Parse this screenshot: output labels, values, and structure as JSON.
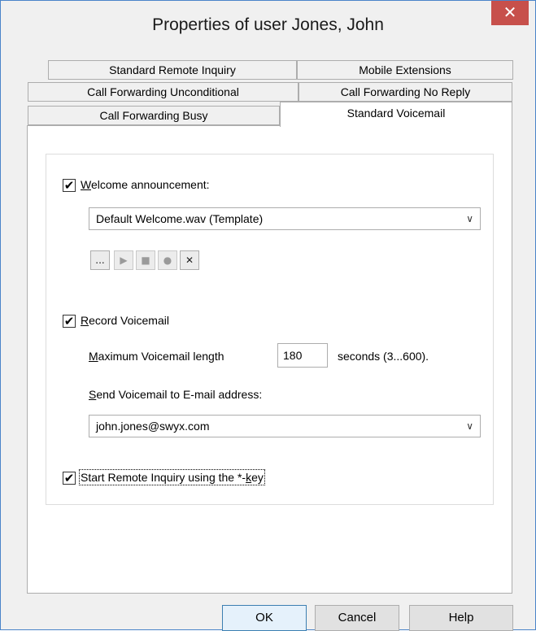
{
  "window": {
    "title": "Properties of user Jones, John",
    "close_glyph": "✕"
  },
  "tabs": [
    {
      "label": "Standard Remote Inquiry"
    },
    {
      "label": "Mobile Extensions"
    },
    {
      "label": "Call Forwarding Unconditional"
    },
    {
      "label": "Call Forwarding No Reply"
    },
    {
      "label": "Call Forwarding Busy"
    },
    {
      "label": "Standard Voicemail",
      "active": true
    }
  ],
  "welcome": {
    "checked": true,
    "check_glyph": "✔",
    "label_hotkey": "W",
    "label_rest": "elcome announcement:",
    "file_value": "Default Welcome.wav (Template)",
    "dropdown_arrow": "∨",
    "controls": [
      {
        "name": "browse",
        "glyph": "...",
        "enabled": true
      },
      {
        "name": "play",
        "glyph": "▶",
        "enabled": false
      },
      {
        "name": "stop",
        "glyph": "■",
        "enabled": false
      },
      {
        "name": "record",
        "glyph": "●",
        "enabled": false
      },
      {
        "name": "delete",
        "glyph": "✕",
        "enabled": true
      }
    ]
  },
  "record_voicemail": {
    "checked": true,
    "check_glyph": "✔",
    "label_hotkey": "R",
    "label_rest": "ecord Voicemail",
    "max_length_hotkey": "M",
    "max_length_rest": "aximum Voicemail length",
    "max_length_value": "180",
    "seconds_label": "seconds (3...600).",
    "send_to_hotkey": "S",
    "send_to_rest": "end Voicemail to E-mail address:",
    "email_value": "john.jones@swyx.com",
    "email_arrow": "∨"
  },
  "remote_inquiry": {
    "checked": true,
    "check_glyph": "✔",
    "label_before": "Start Remote Inquiry using the *-",
    "label_hotkey": "k",
    "label_after": "ey"
  },
  "buttons": {
    "ok": "OK",
    "cancel": "Cancel",
    "help": "Help"
  },
  "colors": {
    "close_button": "#c7504b",
    "panel": "#ffffff",
    "dialog": "#f0f0f0"
  }
}
